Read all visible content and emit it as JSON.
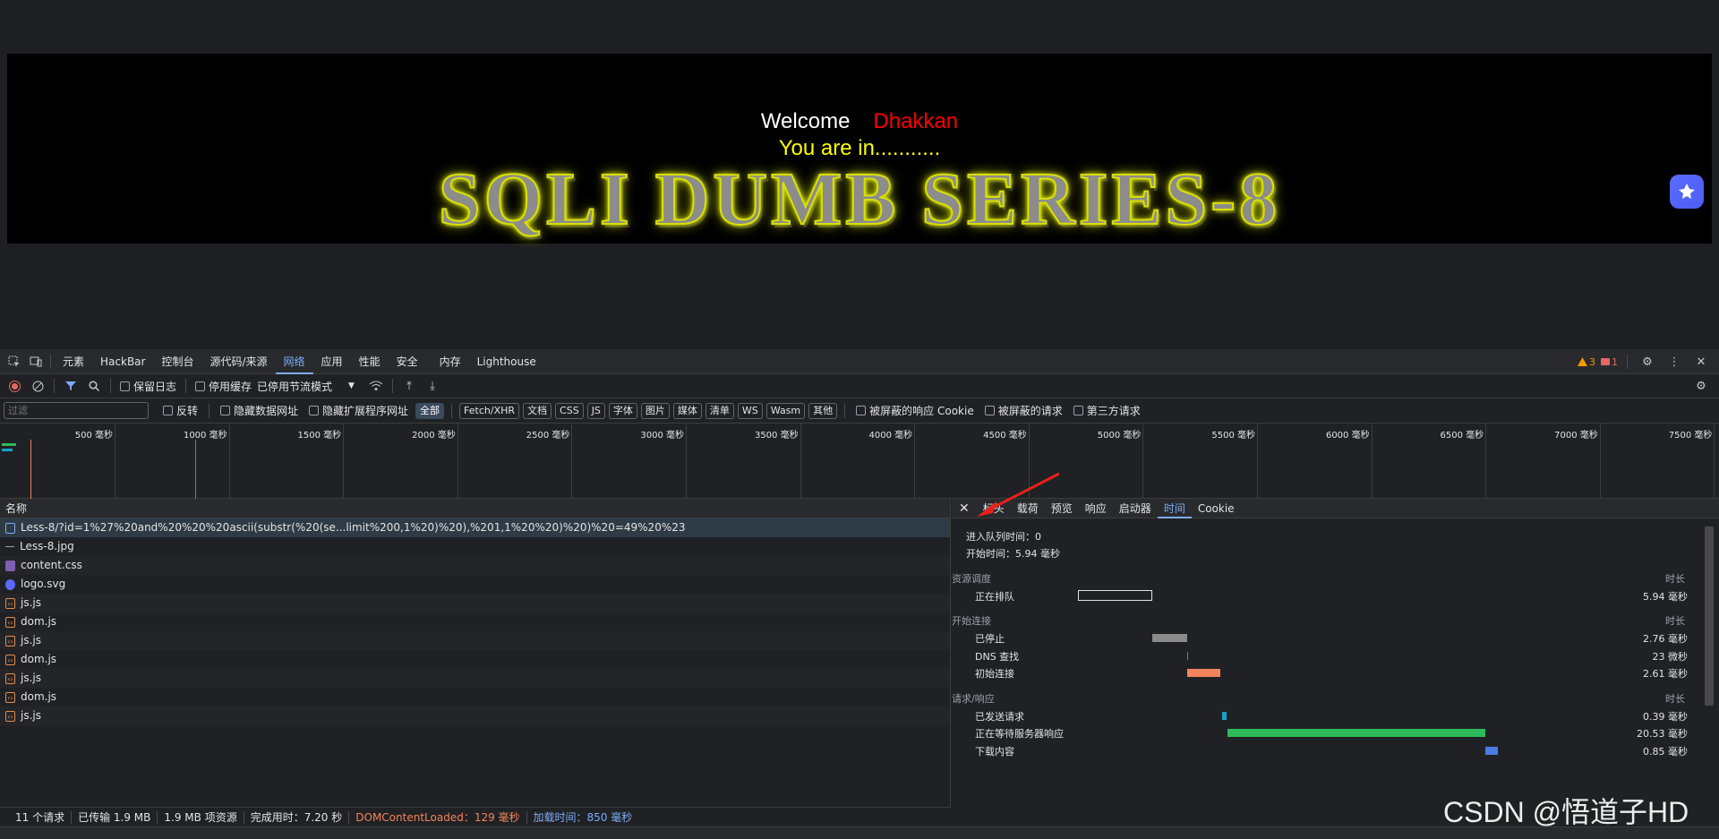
{
  "page": {
    "welcome": "Welcome",
    "name": "Dhakkan",
    "status": "You are in...........",
    "logo_text": "SQLI DUMB SERIES-8"
  },
  "devtools": {
    "tabs": [
      "元素",
      "HackBar",
      "控制台",
      "源代码/来源",
      "网络",
      "应用",
      "性能",
      "安全",
      "内存",
      "Lighthouse"
    ],
    "active_tab": "网络",
    "warnings": "3",
    "errors": "1",
    "toolbar": {
      "preserve_log": "保留日志",
      "disable_cache": "停用缓存",
      "throttle": "已停用节流模式"
    },
    "filter": {
      "placeholder": "过滤",
      "invert": "反转",
      "hide_data_urls": "隐藏数据网址",
      "hide_ext_urls": "隐藏扩展程序网址",
      "types": [
        "全部",
        "Fetch/XHR",
        "文档",
        "CSS",
        "JS",
        "字体",
        "图片",
        "媒体",
        "清单",
        "WS",
        "Wasm",
        "其他"
      ],
      "blocked_cookies": "被屏蔽的响应 Cookie",
      "blocked_requests": "被屏蔽的请求",
      "third_party": "第三方请求"
    },
    "overview_ticks": [
      "500 毫秒",
      "1000 毫秒",
      "1500 毫秒",
      "2000 毫秒",
      "2500 毫秒",
      "3000 毫秒",
      "3500 毫秒",
      "4000 毫秒",
      "4500 毫秒",
      "5000 毫秒",
      "5500 毫秒",
      "6000 毫秒",
      "6500 毫秒",
      "7000 毫秒",
      "7500 毫秒"
    ],
    "list_header": "名称",
    "requests": [
      {
        "name": "Less-8/?id=1%27%20and%20%20%20ascii(substr(%20(se...limit%200,1%20)%20),%201,1%20%20)%20)%20=49%20%23",
        "type": "doc"
      },
      {
        "name": "Less-8.jpg",
        "type": "img"
      },
      {
        "name": "content.css",
        "type": "css"
      },
      {
        "name": "logo.svg",
        "type": "svg"
      },
      {
        "name": "js.js",
        "type": "js"
      },
      {
        "name": "dom.js",
        "type": "js"
      },
      {
        "name": "js.js",
        "type": "js"
      },
      {
        "name": "dom.js",
        "type": "js"
      },
      {
        "name": "js.js",
        "type": "js"
      },
      {
        "name": "dom.js",
        "type": "js"
      },
      {
        "name": "js.js",
        "type": "js"
      }
    ],
    "detail_tabs": [
      "标头",
      "载荷",
      "预览",
      "响应",
      "启动器",
      "时间",
      "Cookie"
    ],
    "active_detail_tab": "时间",
    "timing": {
      "queued_at": "进入队列时间：0",
      "started_at": "开始时间：5.94 毫秒",
      "duration_label": "时长",
      "sections": [
        {
          "title": "资源调度",
          "rows": [
            {
              "label": "正在排队",
              "value": "5.94 毫秒",
              "color": "#ffffff"
            }
          ]
        },
        {
          "title": "开始连接",
          "rows": [
            {
              "label": "已停止",
              "value": "2.76 毫秒",
              "color": "#8a8a8a"
            },
            {
              "label": "DNS 查找",
              "value": "23 微秒",
              "color": "#1aa0c9"
            },
            {
              "label": "初始连接",
              "value": "2.61 毫秒",
              "color": "#f0855c"
            }
          ]
        },
        {
          "title": "请求/响应",
          "rows": [
            {
              "label": "已发送请求",
              "value": "0.39 毫秒",
              "color": "#1aa0c9"
            },
            {
              "label": "正在等待服务器响应",
              "value": "20.53 毫秒",
              "color": "#2dba5a"
            },
            {
              "label": "下载内容",
              "value": "0.85 毫秒",
              "color": "#4c7ae6"
            }
          ]
        }
      ]
    },
    "summary": {
      "requests": "11 个请求",
      "transferred": "已传输 1.9 MB",
      "resources": "1.9 MB 项资源",
      "finish": "完成用时：7.20 秒",
      "dcl": "DOMContentLoaded：129 毫秒",
      "load": "加载时间：850 毫秒"
    }
  },
  "watermark": "CSDN @悟道子HD",
  "colors": {
    "accent": "#7cacf8",
    "dcl": "#f0855c",
    "load": "#7cacf8"
  }
}
